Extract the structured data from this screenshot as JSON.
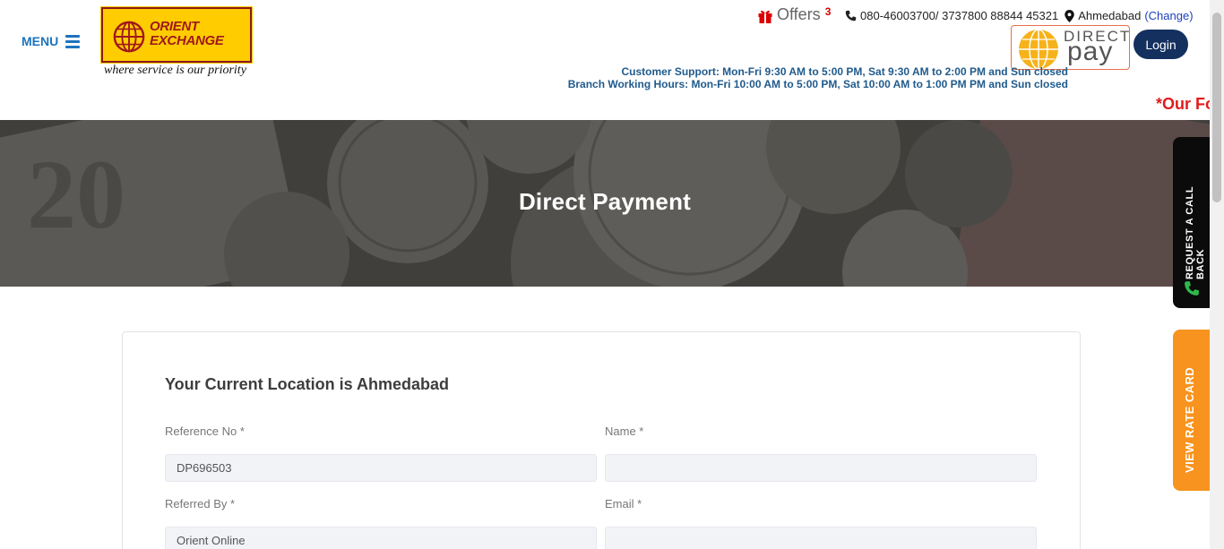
{
  "header": {
    "menu_label": "MENU",
    "logo_line1": "ORIENT",
    "logo_line2": "EXCHANGE",
    "tagline": "where service is our priority",
    "offers_label": "Offers",
    "offers_count": "3",
    "phones": "080-46003700/ 3737800 88844 45321",
    "city": "Ahmedabad",
    "change_label": "(Change)",
    "direct_pay_top": "DIRECT",
    "direct_pay_bottom": "pay",
    "login_label": "Login",
    "support_hours": "Customer Support: Mon-Fri 9:30 AM to 5:00 PM, Sat 9:30 AM to 2:00 PM and Sun closed",
    "branch_hours": "Branch Working Hours: Mon-Fri 10:00 AM to 5:00 PM, Sat 10:00 AM to 1:00 PM PM and Sun closed",
    "marquee_text": "*Our Fo"
  },
  "banner": {
    "title": "Direct Payment"
  },
  "side_tabs": {
    "callback_label": "REQUEST A CALL BACK",
    "rate_card_label": "VIEW RATE CARD"
  },
  "form": {
    "heading": "Your Current Location is Ahmedabad",
    "reference_label": "Reference No *",
    "reference_value": "DP696503",
    "name_label": "Name *",
    "name_value": "",
    "referred_label": "Referred By *",
    "referred_value": "Orient Online",
    "email_label": "Email *",
    "email_value": ""
  },
  "colors": {
    "brand_blue": "#1e73be",
    "login_bg": "#14305f",
    "rate_card_bg": "#f7931e",
    "marquee_red": "#e01b1b",
    "logo_yellow": "#ffcc00"
  }
}
